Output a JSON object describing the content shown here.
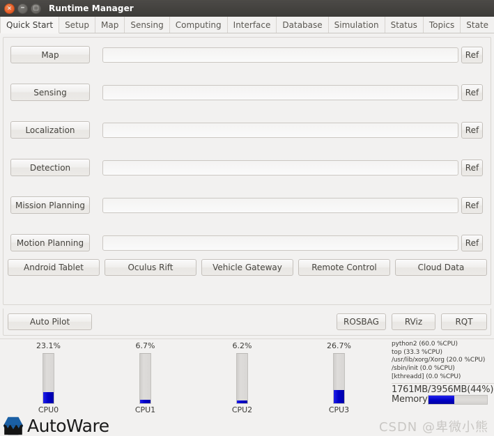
{
  "window": {
    "title": "Runtime Manager",
    "buttons": {
      "close": "×",
      "minimize": "–",
      "maximize": "▢"
    }
  },
  "tabs": [
    {
      "label": "Quick Start",
      "active": true
    },
    {
      "label": "Setup",
      "active": false
    },
    {
      "label": "Map",
      "active": false
    },
    {
      "label": "Sensing",
      "active": false
    },
    {
      "label": "Computing",
      "active": false
    },
    {
      "label": "Interface",
      "active": false
    },
    {
      "label": "Database",
      "active": false
    },
    {
      "label": "Simulation",
      "active": false
    },
    {
      "label": "Status",
      "active": false
    },
    {
      "label": "Topics",
      "active": false
    },
    {
      "label": "State",
      "active": false
    }
  ],
  "launch_rows": [
    {
      "label": "Map",
      "value": "",
      "placeholder": "",
      "ref": "Ref"
    },
    {
      "label": "Sensing",
      "value": "",
      "placeholder": "",
      "ref": "Ref"
    },
    {
      "label": "Localization",
      "value": "",
      "placeholder": "",
      "ref": "Ref"
    },
    {
      "label": "Detection",
      "value": "",
      "placeholder": "",
      "ref": "Ref"
    },
    {
      "label": "Mission Planning",
      "value": "",
      "placeholder": "",
      "ref": "Ref"
    },
    {
      "label": "Motion Planning",
      "value": "",
      "placeholder": "",
      "ref": "Ref"
    }
  ],
  "device_buttons": [
    {
      "label": "Android Tablet"
    },
    {
      "label": "Oculus Rift"
    },
    {
      "label": "Vehicle Gateway"
    },
    {
      "label": "Remote Control"
    },
    {
      "label": "Cloud Data"
    }
  ],
  "toolbar": {
    "auto_pilot": "Auto Pilot",
    "rosbag": "ROSBAG",
    "rviz": "RViz",
    "rqt": "RQT"
  },
  "monitor": {
    "cpus": [
      {
        "name": "CPU0",
        "percent_label": "23.1%",
        "percent": 23.1
      },
      {
        "name": "CPU1",
        "percent_label": "6.7%",
        "percent": 6.7
      },
      {
        "name": "CPU2",
        "percent_label": "6.2%",
        "percent": 6.2
      },
      {
        "name": "CPU3",
        "percent_label": "26.7%",
        "percent": 26.7
      }
    ],
    "processes": [
      "python2 (60.0 %CPU)",
      "top (33.3 %CPU)",
      "/usr/lib/xorg/Xorg (20.0 %CPU)",
      "/sbin/init (0.0 %CPU)",
      "[kthreadd] (0.0 %CPU)"
    ],
    "memory": {
      "text": "1761MB/3956MB(44%)",
      "label": "Memory",
      "percent": 44
    }
  },
  "branding": {
    "wordmark": "AutoWare",
    "logo_colors": {
      "top": "#1a5fa4",
      "bottom": "#141414"
    }
  },
  "watermark": "CSDN @卑微小熊",
  "colors": {
    "accent_blue": "#0000c8",
    "window_bg": "#f2f1f0",
    "titlebar": "#3c3b38",
    "close_button": "#e8612c"
  }
}
